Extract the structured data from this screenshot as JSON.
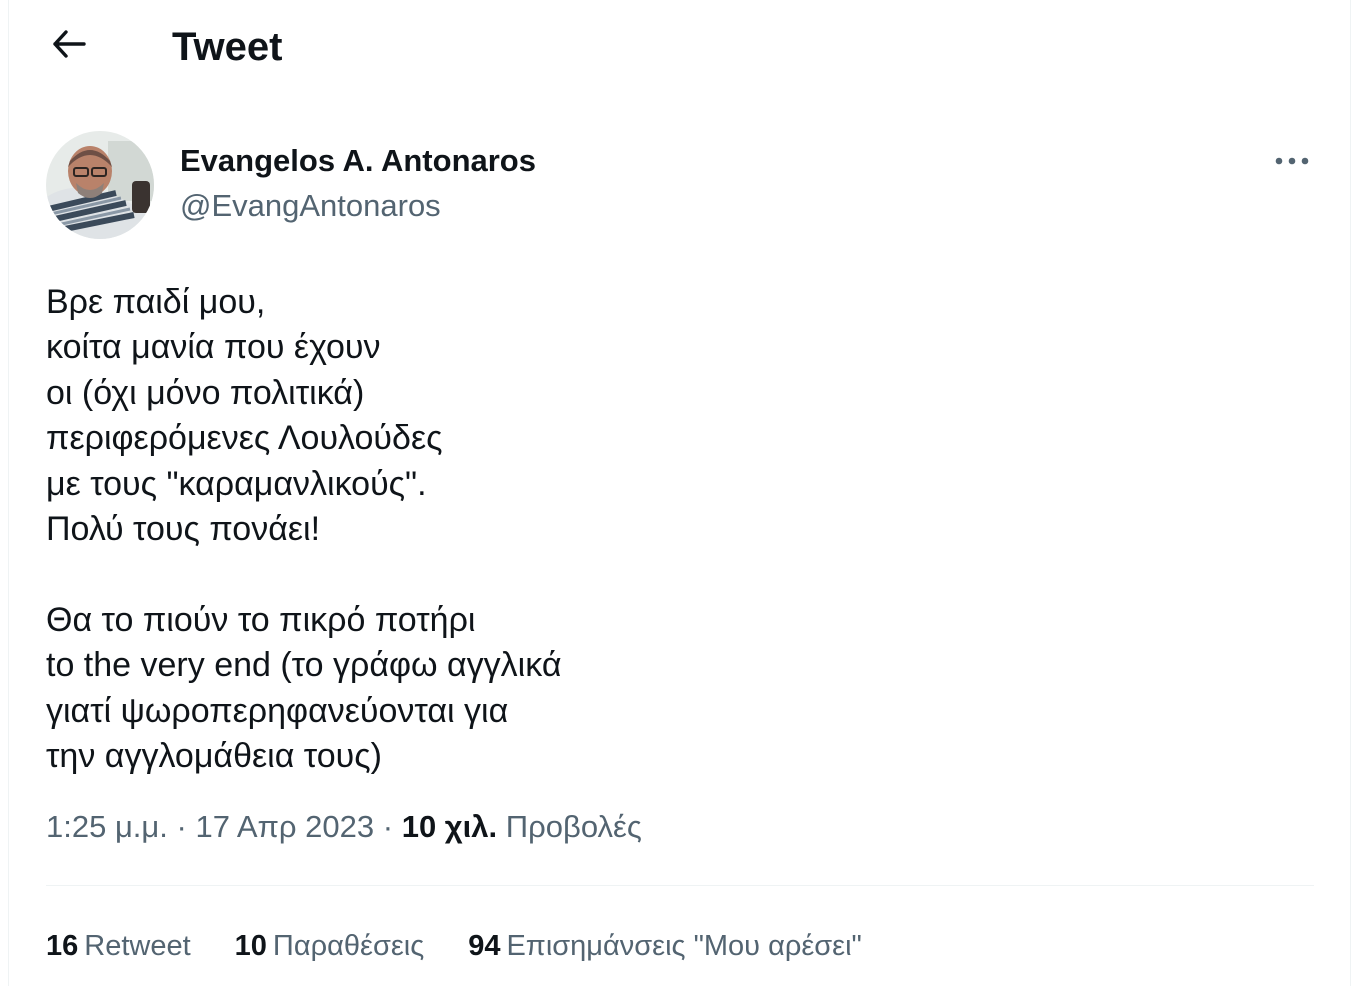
{
  "header": {
    "title": "Tweet"
  },
  "tweet": {
    "author": {
      "display_name": "Evangelos A. Antonaros",
      "handle": "@EvangAntonaros"
    },
    "text": "Βρε παιδί μου,\nκοίτα μανία που έχουν\nοι (όχι μόνο πολιτικά)\nπεριφερόμενες Λουλούδες\nμε τους \"καραμανλικούς\".\nΠολύ τους πονάει!\n\nΘα το πιούν το πικρό ποτήρι\nto the very end (το γράφω αγγλικά\nγιατί ψωροπερηφανεύονται για\nτην αγγλομάθεια τους)",
    "time": "1:25 μ.μ.",
    "date": "17 Απρ 2023",
    "views_count": "10 χιλ.",
    "views_label": "Προβολές"
  },
  "stats": {
    "retweets": {
      "count": "16",
      "label": "Retweet"
    },
    "quotes": {
      "count": "10",
      "label": "Παραθέσεις"
    },
    "likes": {
      "count": "94",
      "label": "Επισημάνσεις \"Μου αρέσει\""
    }
  },
  "colors": {
    "text": "#0f1419",
    "secondary": "#536471",
    "divider": "#eff3f4"
  }
}
